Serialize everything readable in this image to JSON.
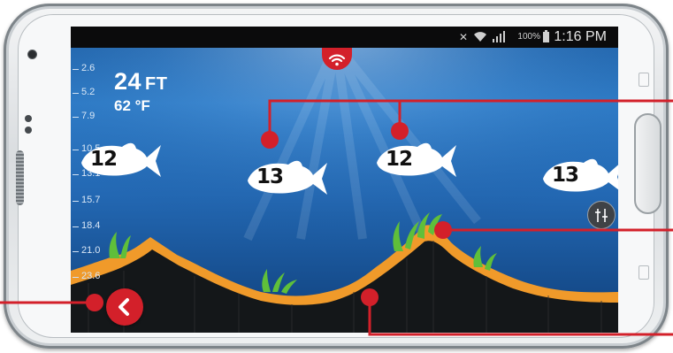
{
  "statusbar": {
    "battery_percent": "100%",
    "time": "1:16 PM",
    "icons": [
      "mute-icon",
      "wifi-icon",
      "signal-icon",
      "battery-icon"
    ]
  },
  "readout": {
    "depth_value": "24",
    "depth_unit": "FT",
    "temperature": "62 °F"
  },
  "depth_scale": [
    "2.6",
    "5.2",
    "7.9",
    "10.5",
    "13.1",
    "15.7",
    "18.4",
    "21.0",
    "23.6"
  ],
  "fish": [
    {
      "label": "12"
    },
    {
      "label": "13"
    },
    {
      "label": "12"
    },
    {
      "label": "13"
    }
  ],
  "controls": {
    "wifi_tab_icon": "wifi-icon",
    "back_icon": "chevron-left-icon",
    "settings_icon": "sliders-icon"
  },
  "colors": {
    "accent_red": "#d3202a",
    "water_deep": "#0d3d74",
    "water_light": "#3d8fd6",
    "bottom_orange": "#f09a2a",
    "vegetation_green": "#5fbf3a"
  }
}
